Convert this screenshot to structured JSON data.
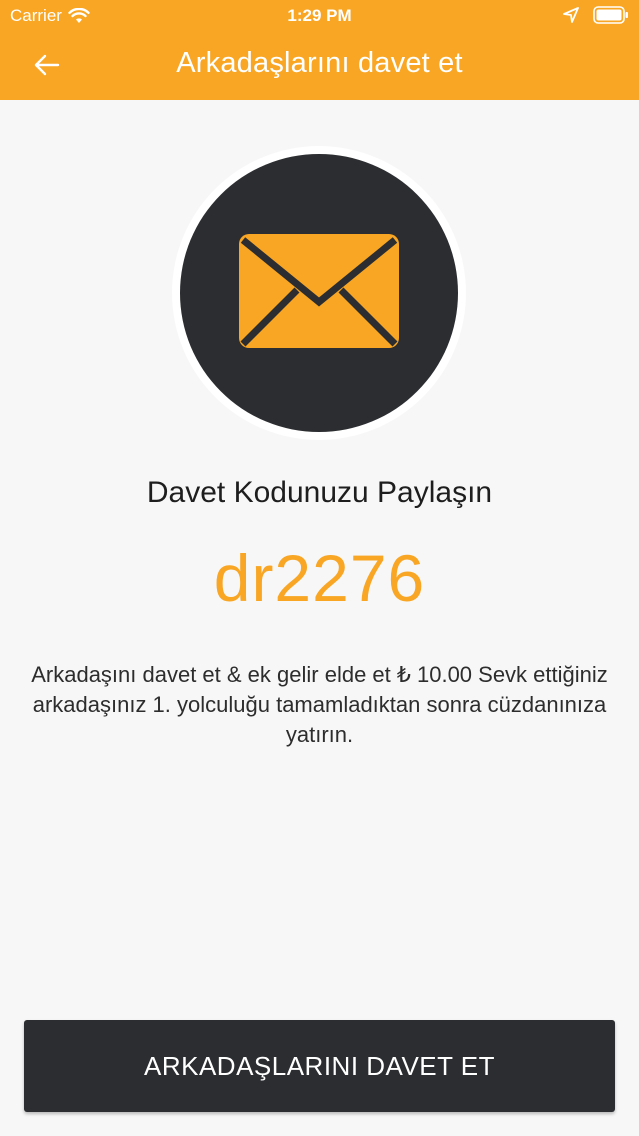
{
  "status_bar": {
    "carrier": "Carrier",
    "time": "1:29 PM",
    "icons": [
      "wifi-icon",
      "location-icon",
      "battery-icon"
    ]
  },
  "nav": {
    "back_icon": "arrow-left-icon",
    "title": "Arkadaşlarını davet et"
  },
  "hero": {
    "icon": "envelope-icon"
  },
  "main": {
    "share_title": "Davet Kodunuzu Paylaşın",
    "invite_code": "dr2276",
    "description": "Arkadaşını davet et & ek gelir elde et ₺ 10.00 Sevk ettiğiniz arkadaşınız 1. yolculuğu tamamladıktan sonra cüzdanınıza yatırın."
  },
  "footer": {
    "invite_button_label": "ARKADAŞLARINI DAVET ET"
  },
  "colors": {
    "accent": "#f8a623",
    "dark": "#2b2d30",
    "background": "#f7f7f7"
  }
}
